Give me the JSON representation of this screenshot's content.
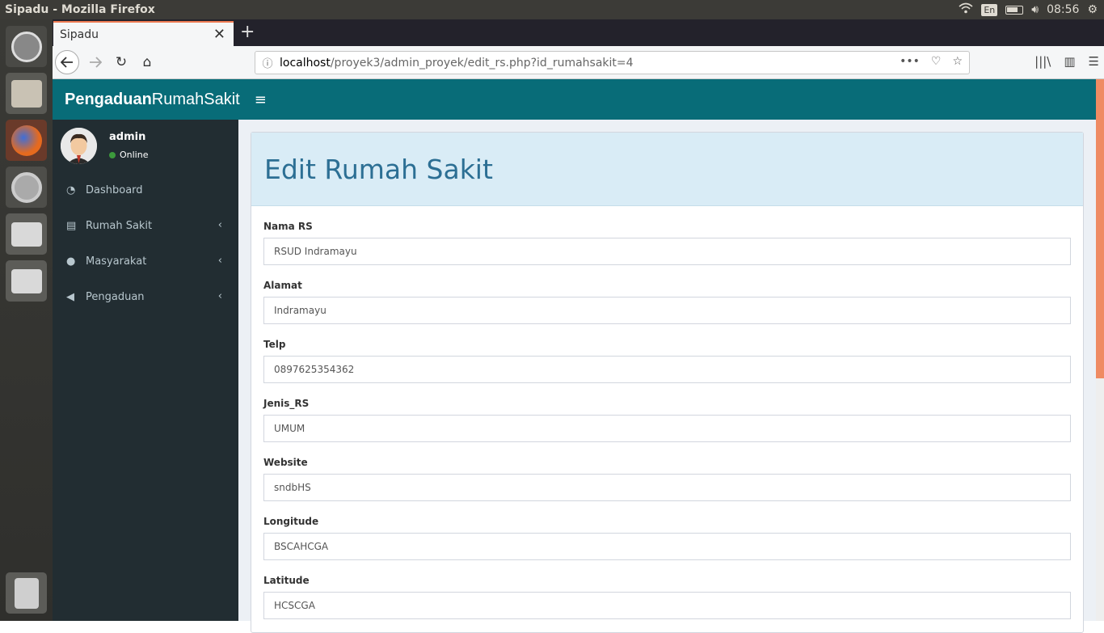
{
  "os": {
    "window_title": "Sipadu - Mozilla Firefox",
    "lang": "En",
    "time": "08:56"
  },
  "browser": {
    "tab_title": "Sipadu",
    "url_host": "localhost",
    "url_path": "/proyek3/admin_proyek/edit_rs.php?id_rumahsakit=4"
  },
  "app": {
    "brand_bold": "Pengaduan",
    "brand_light": "RumahSakit",
    "user": {
      "name": "admin",
      "status": "Online"
    },
    "menu": [
      {
        "label": "Dashboard",
        "icon": "dashboard-icon"
      },
      {
        "label": "Rumah Sakit",
        "icon": "clipboard-icon"
      },
      {
        "label": "Masyarakat",
        "icon": "users-icon"
      },
      {
        "label": "Pengaduan",
        "icon": "bullhorn-icon"
      }
    ]
  },
  "page": {
    "heading": "Edit Rumah Sakit",
    "fields": [
      {
        "label": "Nama RS",
        "value": "RSUD Indramayu"
      },
      {
        "label": "Alamat",
        "value": "Indramayu"
      },
      {
        "label": "Telp",
        "value": "0897625354362"
      },
      {
        "label": "Jenis_RS",
        "value": "UMUM"
      },
      {
        "label": "Website",
        "value": "sndbHS"
      },
      {
        "label": "Longitude",
        "value": "BSCAHCGA"
      },
      {
        "label": "Latitude",
        "value": "HCSCGA"
      }
    ]
  },
  "colors": {
    "header": "#086c78",
    "sidebar": "#222d32",
    "accent_tab": "#ee7a52",
    "heading": "#2c6f94"
  }
}
